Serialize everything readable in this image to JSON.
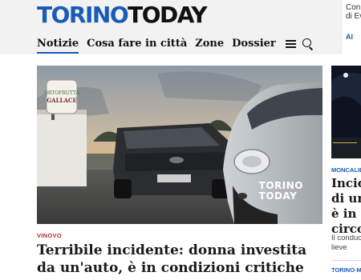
{
  "header": {
    "logo_part1": "TORINO",
    "logo_part2": "TODAY",
    "nav": {
      "items": [
        "Notizie",
        "Cosa fare in città",
        "Zone",
        "Dossier"
      ],
      "active": "Notizie",
      "menu_icon": "hamburger-menu-icon",
      "search_icon": "search-icon"
    },
    "promo": {
      "line1": "Con",
      "line2": "di Ev",
      "cta": "Al"
    }
  },
  "main_article": {
    "image_alt": "Van and car at a roadside stop with an Ortofrutta Gallace sign",
    "sign_line1": "ORTOFRUTTA",
    "sign_line2": "GALLACE",
    "watermark_line1": "TORINO",
    "watermark_line2": "TODAY",
    "category": "VINOVO",
    "headline": "Terribile incidente: donna investita da un'auto, è in condizioni critiche"
  },
  "side_article": {
    "category": "MONCALIE",
    "title": "Incide\ndi un t\nè in m\ncircola",
    "summary": "Il conduc\nlieve",
    "next_category": "TORINO-MI"
  },
  "colors": {
    "brand_blue": "#1a5bb8",
    "category_red": "#b02a30",
    "text_dark": "#1a1a1a"
  }
}
